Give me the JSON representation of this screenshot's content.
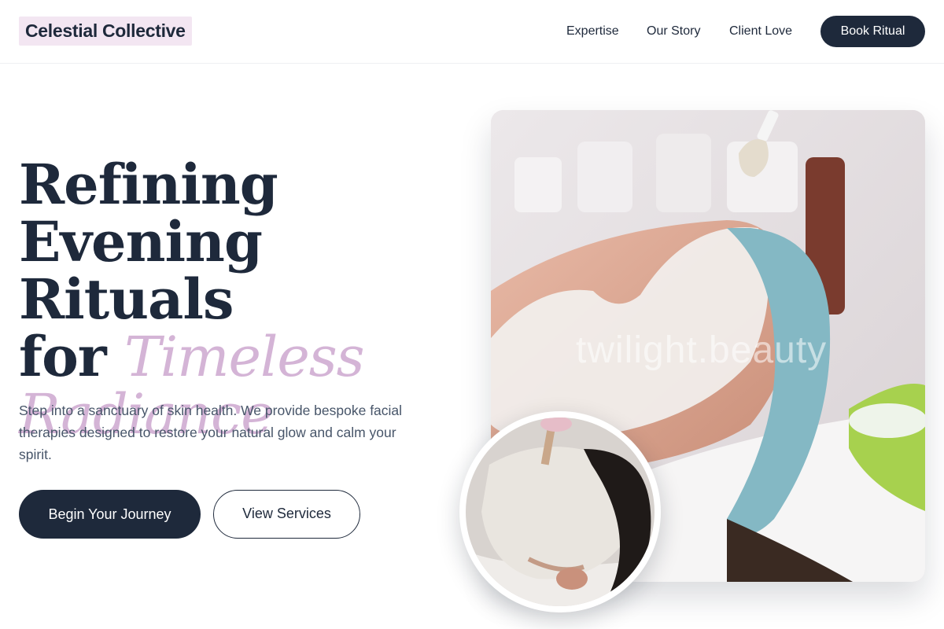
{
  "header": {
    "logo": "Celestial Collective",
    "nav": [
      "Expertise",
      "Our Story",
      "Client Love"
    ],
    "cta": "Book Ritual"
  },
  "hero": {
    "headline_line1": "Refining",
    "headline_line2": "Evening Rituals",
    "headline_line3_plain": "for",
    "headline_line3_accent": "Timeless",
    "headline_line4_accent": "Radiance",
    "description": "Step into a sanctuary of skin health. We provide bespoke facial therapies designed to restore your natural glow and calm your spirit.",
    "primary_cta": "Begin Your Journey",
    "secondary_cta": "View Services",
    "image_watermark": "twilight.beauty"
  },
  "colors": {
    "navy": "#1e293b",
    "accent_lilac": "#d4b4d6",
    "logo_bg": "#f3e6f2",
    "body_text": "#475569"
  }
}
